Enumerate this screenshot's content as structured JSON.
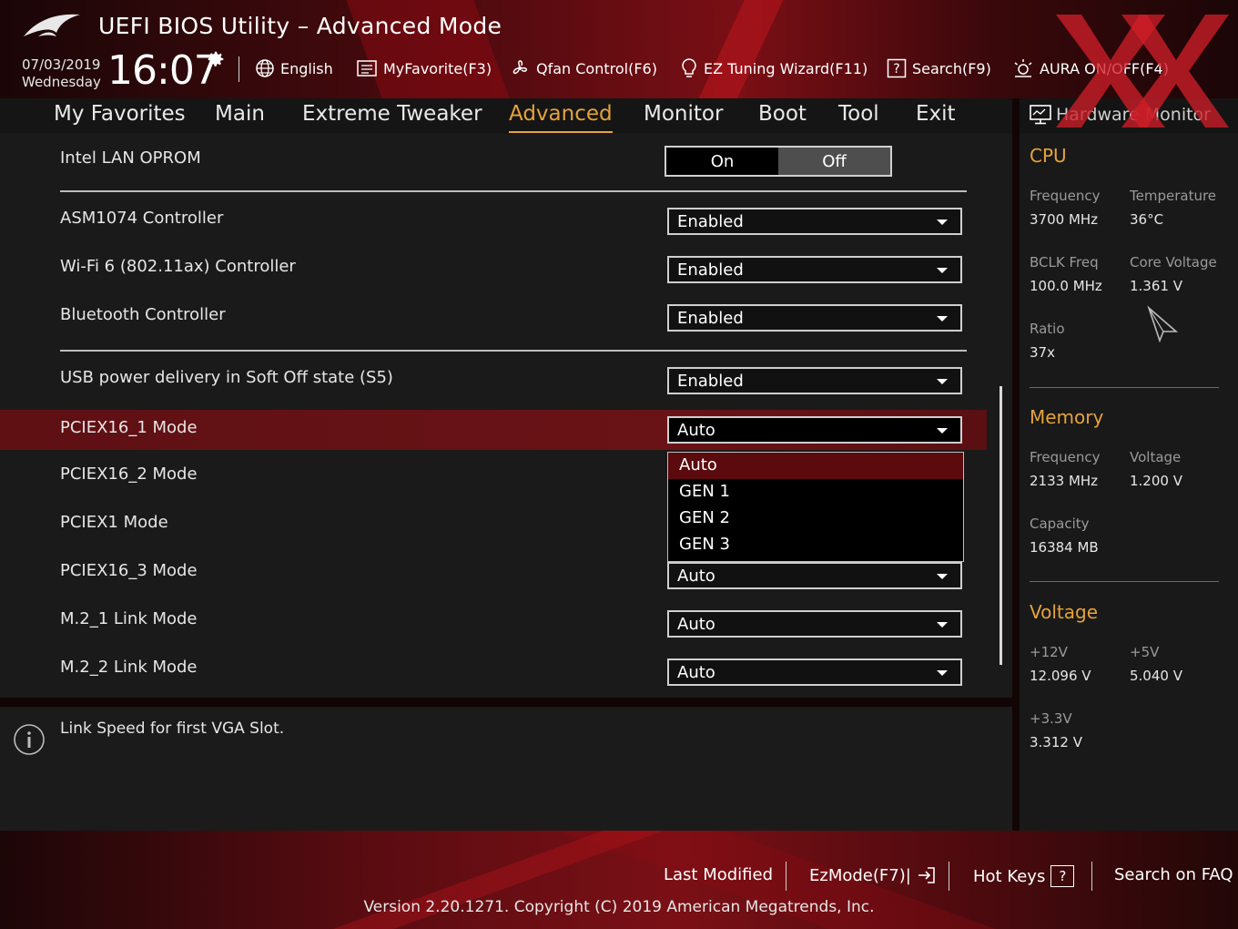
{
  "app": {
    "title": "UEFI BIOS Utility – Advanced Mode",
    "date": "07/03/2019",
    "weekday": "Wednesday",
    "time": "16:07"
  },
  "toolbar": {
    "language": "English",
    "myfavorite": "MyFavorite(F3)",
    "qfan": "Qfan Control(F6)",
    "ez_tuning": "EZ Tuning Wizard(F11)",
    "search": "Search(F9)",
    "aura": "AURA ON/OFF(F4)"
  },
  "menu": {
    "items": [
      {
        "label": "My Favorites"
      },
      {
        "label": "Main"
      },
      {
        "label": "Extreme Tweaker"
      },
      {
        "label": "Advanced"
      },
      {
        "label": "Monitor"
      },
      {
        "label": "Boot"
      },
      {
        "label": "Tool"
      },
      {
        "label": "Exit"
      }
    ],
    "active": "Advanced"
  },
  "settings": {
    "lan_oprom": {
      "label": "Intel LAN OPROM",
      "on": "On",
      "off": "Off",
      "selected": "Off"
    },
    "rows": [
      {
        "label": "ASM1074 Controller",
        "value": "Enabled"
      },
      {
        "label": "Wi-Fi 6 (802.11ax) Controller",
        "value": "Enabled"
      },
      {
        "label": "Bluetooth Controller",
        "value": "Enabled"
      },
      {
        "label": "USB power delivery in Soft Off state (S5)",
        "value": "Enabled"
      },
      {
        "label": "PCIEX16_1 Mode",
        "value": "Auto"
      },
      {
        "label": "PCIEX16_2 Mode",
        "value": ""
      },
      {
        "label": "PCIEX1 Mode",
        "value": ""
      },
      {
        "label": "PCIEX16_3 Mode",
        "value": "Auto"
      },
      {
        "label": "M.2_1 Link Mode",
        "value": "Auto"
      },
      {
        "label": "M.2_2 Link Mode",
        "value": "Auto"
      }
    ],
    "dropdown_options": [
      "Auto",
      "GEN 1",
      "GEN 2",
      "GEN 3"
    ],
    "dropdown_highlight": "Auto"
  },
  "help": {
    "text": "Link Speed for first VGA Slot."
  },
  "hardware_monitor": {
    "title": "Hardware Monitor",
    "cpu": {
      "heading": "CPU",
      "frequency_label": "Frequency",
      "frequency": "3700 MHz",
      "temperature_label": "Temperature",
      "temperature": "36°C",
      "bclk_label": "BCLK Freq",
      "bclk": "100.0 MHz",
      "core_voltage_label": "Core Voltage",
      "core_voltage": "1.361 V",
      "ratio_label": "Ratio",
      "ratio": "37x"
    },
    "memory": {
      "heading": "Memory",
      "frequency_label": "Frequency",
      "frequency": "2133 MHz",
      "voltage_label": "Voltage",
      "voltage": "1.200 V",
      "capacity_label": "Capacity",
      "capacity": "16384 MB"
    },
    "voltage": {
      "heading": "Voltage",
      "v12_label": "+12V",
      "v12": "12.096 V",
      "v5_label": "+5V",
      "v5": "5.040 V",
      "v33_label": "+3.3V",
      "v33": "3.312 V"
    }
  },
  "footer": {
    "last_modified": "Last Modified",
    "ezmode": "EzMode(F7)|",
    "hot_keys": "Hot Keys",
    "hot_keys_key": "?",
    "search_faq": "Search on FAQ",
    "version": "Version 2.20.1271. Copyright (C) 2019 American Megatrends, Inc."
  },
  "colors": {
    "accent": "#e6a23c",
    "selected_row": "#6a1317",
    "brand_red": "#7a0f15"
  }
}
